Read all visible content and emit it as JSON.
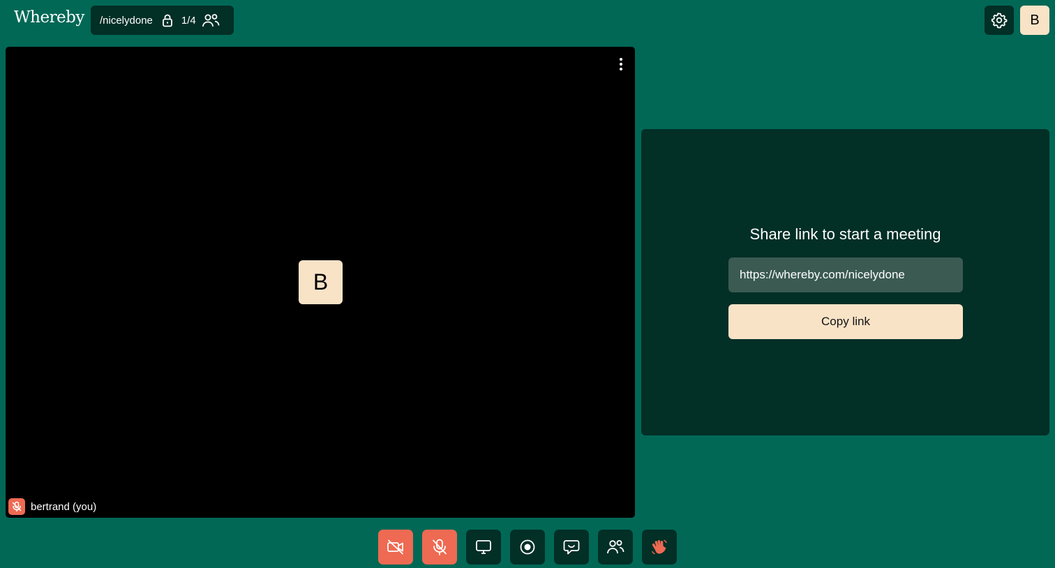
{
  "header": {
    "logo": "Whereby",
    "room_name": "/nicelydone",
    "participant_count": "1/4",
    "avatar_initial": "B"
  },
  "video_tile": {
    "avatar_initial": "B",
    "participant_label": "bertrand (you)"
  },
  "share_panel": {
    "title": "Share link to start a meeting",
    "url": "https://whereby.com/nicelydone",
    "copy_label": "Copy link"
  },
  "toolbar": {
    "buttons": [
      {
        "icon": "camera-off-icon",
        "state": "off"
      },
      {
        "icon": "mic-off-icon",
        "state": "off"
      },
      {
        "icon": "screen-share-icon",
        "state": "default"
      },
      {
        "icon": "record-icon",
        "state": "default"
      },
      {
        "icon": "chat-icon",
        "state": "default"
      },
      {
        "icon": "people-icon",
        "state": "default"
      },
      {
        "icon": "wave-hand-icon",
        "state": "default"
      }
    ]
  },
  "colors": {
    "background": "#016856",
    "panel": "#022f26",
    "accent_cream": "#f9e3c7",
    "alert": "#ee6a52"
  }
}
